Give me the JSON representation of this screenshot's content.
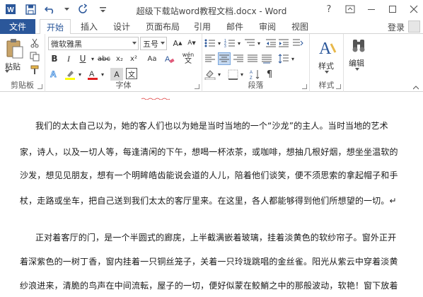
{
  "window": {
    "title": "超级下载站word教程文档.docx - Word",
    "help_label": "?",
    "login_label": "登录"
  },
  "tabs": [
    {
      "label": "文件"
    },
    {
      "label": "开始"
    },
    {
      "label": "插入"
    },
    {
      "label": "设计"
    },
    {
      "label": "页面布局"
    },
    {
      "label": "引用"
    },
    {
      "label": "邮件"
    },
    {
      "label": "审阅"
    },
    {
      "label": "视图"
    }
  ],
  "ribbon": {
    "clipboard": {
      "label": "剪贴板",
      "paste_label": "粘贴"
    },
    "font": {
      "label": "字体",
      "font_name": "微软雅黑",
      "font_size": "五号",
      "bold": "B",
      "italic": "I",
      "underline": "U",
      "strike": "abc",
      "subscript": "x₂",
      "superscript": "x²",
      "grow": "A",
      "shrink": "A",
      "aa": "Aa",
      "wen": "wén",
      "wen_char": "文",
      "a_char": "A"
    },
    "paragraph": {
      "label": "段落"
    },
    "styles": {
      "label": "样式",
      "button_label": "样式"
    },
    "editing": {
      "label": "编辑",
      "button_label": "编辑"
    }
  },
  "document": {
    "lines": [
      "我们的太太自己以为，她的客人们也以为她是当时当地的一个“沙龙”的主人。当时当地的艺术",
      "家，诗人，以及一切人等，每逢清闲的下午，想喝一杯浓茶，或咖啡，想抽几根好烟，想坐坐温软的",
      "沙发，想见见朋友，想有一个明眸皓齿能说会道的人儿，陪着他们谈笑，便不须思索的拿起帽子和手",
      "杖，走路或坐车，把自己送到我们太太的客厅里来。在这里，各人都能够得到他们所想望的一切。↵",
      "正对着客厅的门，是一个半圆式的廊庑，上半截满嵌着玻璃，挂着淡黄色的软纱帘子。窗外正开",
      "着深紫色的一树丁香，窗内挂着一只铜丝笼子，关着一只玲珑跳唱的金丝雀。阳光从紫云中穿着淡黄",
      "纱浪进来，清脆的鸟声在中间流転，屋子的一切，便好似蒙在鲛鮹之中的那般波动，软艳！窗下放着"
    ]
  }
}
